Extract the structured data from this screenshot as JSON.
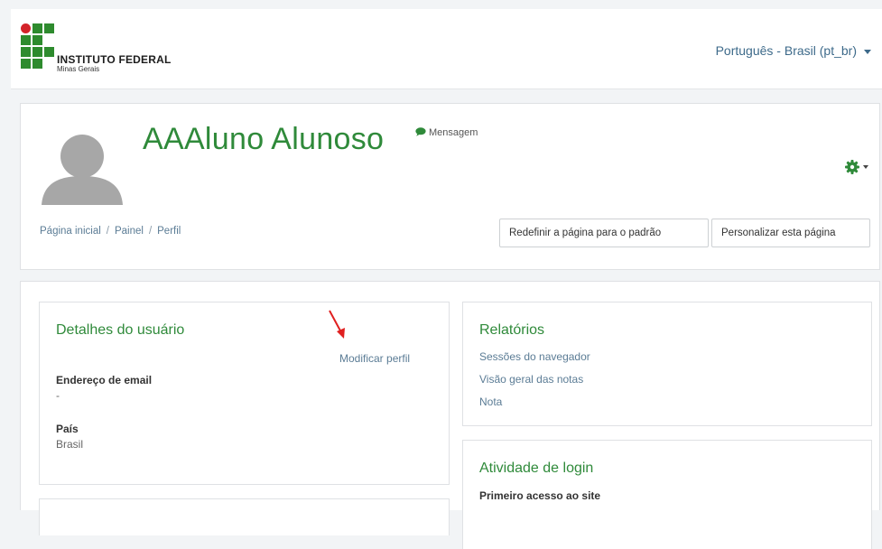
{
  "header": {
    "logo": {
      "title": "INSTITUTO FEDERAL",
      "subtitle": "Minas Gerais"
    },
    "language": "Português - Brasil (pt_br)"
  },
  "profile": {
    "name": "AAAluno Alunoso",
    "message_label": "Mensagem",
    "breadcrumb": [
      "Página inicial",
      "Painel",
      "Perfil"
    ],
    "reset_button": "Redefinir a página para o padrão",
    "customize_button": "Personalizar esta página"
  },
  "user_details": {
    "title": "Detalhes do usuário",
    "edit_link": "Modificar perfil",
    "email_label": "Endereço de email",
    "email_value": "-",
    "country_label": "País",
    "country_value": "Brasil"
  },
  "reports": {
    "title": "Relatórios",
    "links": [
      "Sessões do navegador",
      "Visão geral das notas",
      "Nota"
    ]
  },
  "login_activity": {
    "title": "Atividade de login",
    "first_access_label": "Primeiro acesso ao site"
  },
  "colors": {
    "accent_green": "#2f8a3a",
    "link_blue": "#5b7c95",
    "arrow_red": "#e02020"
  }
}
